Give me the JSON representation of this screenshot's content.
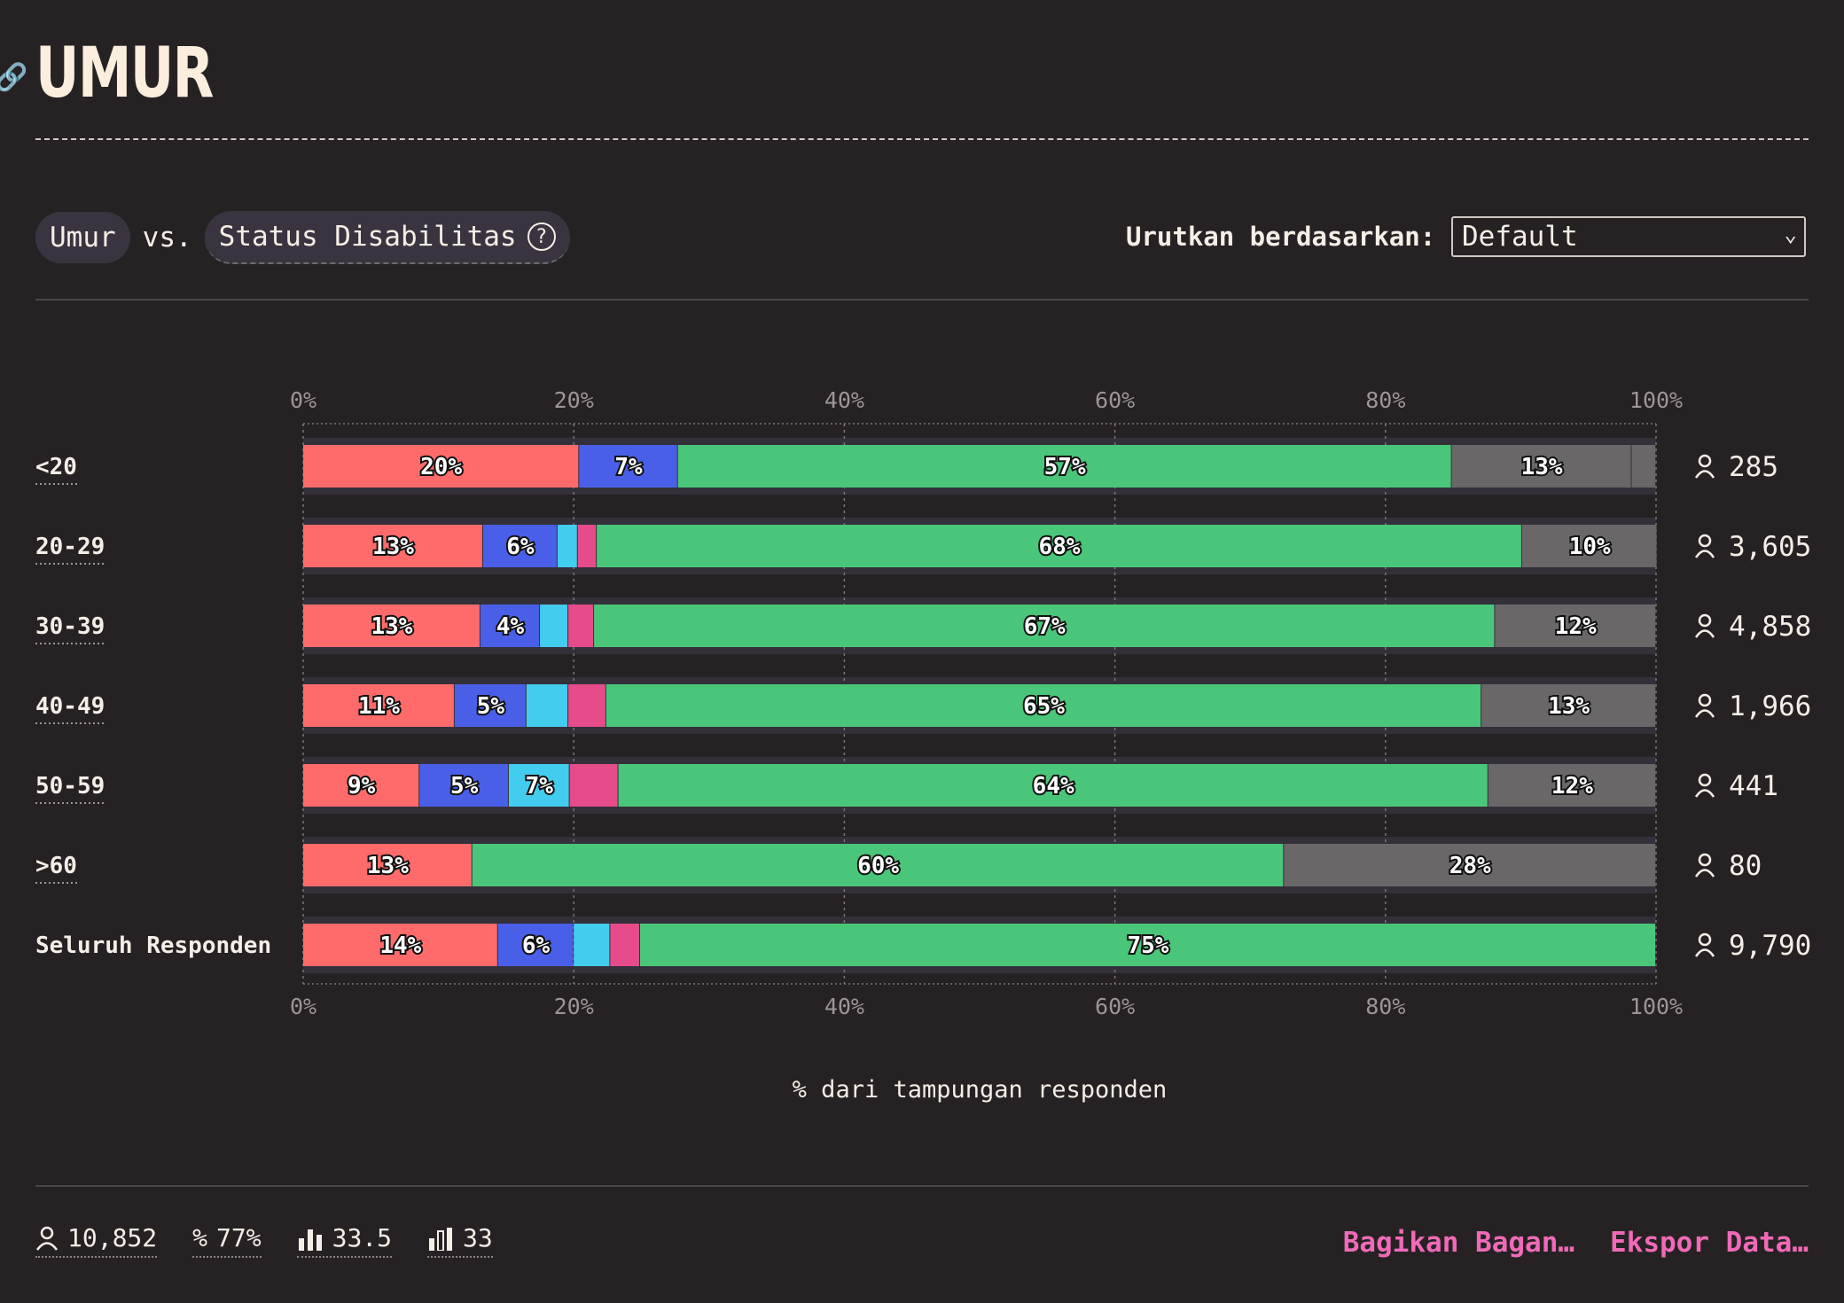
{
  "header": {
    "title": "UMUR"
  },
  "controls": {
    "primary": "Umur",
    "vs": "vs.",
    "secondary": "Status Disabilitas",
    "sort_label": "Urutkan berdasarkan:",
    "sort_value": "Default"
  },
  "footer": {
    "respondents": "10,852",
    "percent": "77%",
    "mean": "33.5",
    "median": "33",
    "share": "Bagikan Bagan…",
    "export": "Ekspor Data…"
  },
  "colors": {
    "series": [
      "#ff6b6b",
      "#4a5fe8",
      "#42ccee",
      "#e64b8a",
      "#4ac67a",
      "#6a6769"
    ],
    "background": "#262224",
    "track": "#34303a"
  },
  "chart_data": {
    "type": "bar",
    "orientation": "horizontal",
    "stacked": true,
    "xlabel": "% dari tampungan responden",
    "xlim": [
      0,
      100
    ],
    "ticks": [
      "0%",
      "20%",
      "40%",
      "60%",
      "80%",
      "100%"
    ],
    "grid": true,
    "categories": [
      "<20",
      "20-29",
      "30-39",
      "40-49",
      "50-59",
      ">60",
      "Seluruh Responden"
    ],
    "counts": [
      "285",
      "3,605",
      "4,858",
      "1,966",
      "441",
      "80",
      "9,790"
    ],
    "series": [
      {
        "values": [
          20.4,
          13.3,
          13.1,
          11.2,
          8.6,
          12.5,
          14.4
        ],
        "color": "#ff6b6b"
      },
      {
        "values": [
          7.3,
          5.5,
          4.4,
          5.3,
          6.6,
          0,
          5.6
        ],
        "color": "#4a5fe8"
      },
      {
        "values": [
          0,
          1.5,
          2.1,
          3.1,
          4.5,
          0,
          2.7
        ],
        "color": "#42ccee"
      },
      {
        "values": [
          0,
          1.4,
          1.9,
          2.8,
          3.6,
          0,
          2.2
        ],
        "color": "#e64b8a"
      },
      {
        "values": [
          57.2,
          68.4,
          66.6,
          64.7,
          64.3,
          60.0,
          75.1
        ],
        "color": "#4ac67a"
      },
      {
        "values": [
          13.3,
          10.0,
          11.9,
          12.9,
          12.4,
          27.5,
          0
        ],
        "color": "#6a6769"
      },
      {
        "values": [
          1.8,
          0,
          0,
          0,
          0,
          0,
          0
        ],
        "color": "#6a6769"
      }
    ],
    "labels": [
      [
        "20%",
        "7%",
        "",
        "",
        "57%",
        "13%",
        ""
      ],
      [
        "13%",
        "6%",
        "",
        "",
        "68%",
        "10%",
        ""
      ],
      [
        "13%",
        "4%",
        "",
        "",
        "67%",
        "12%",
        ""
      ],
      [
        "11%",
        "5%",
        "",
        "",
        "65%",
        "13%",
        ""
      ],
      [
        "9%",
        "5%",
        "7%",
        "",
        "64%",
        "12%",
        ""
      ],
      [
        "13%",
        "",
        "",
        "",
        "60%",
        "28%",
        ""
      ],
      [
        "14%",
        "6%",
        "",
        "",
        "75%",
        "",
        ""
      ]
    ]
  }
}
